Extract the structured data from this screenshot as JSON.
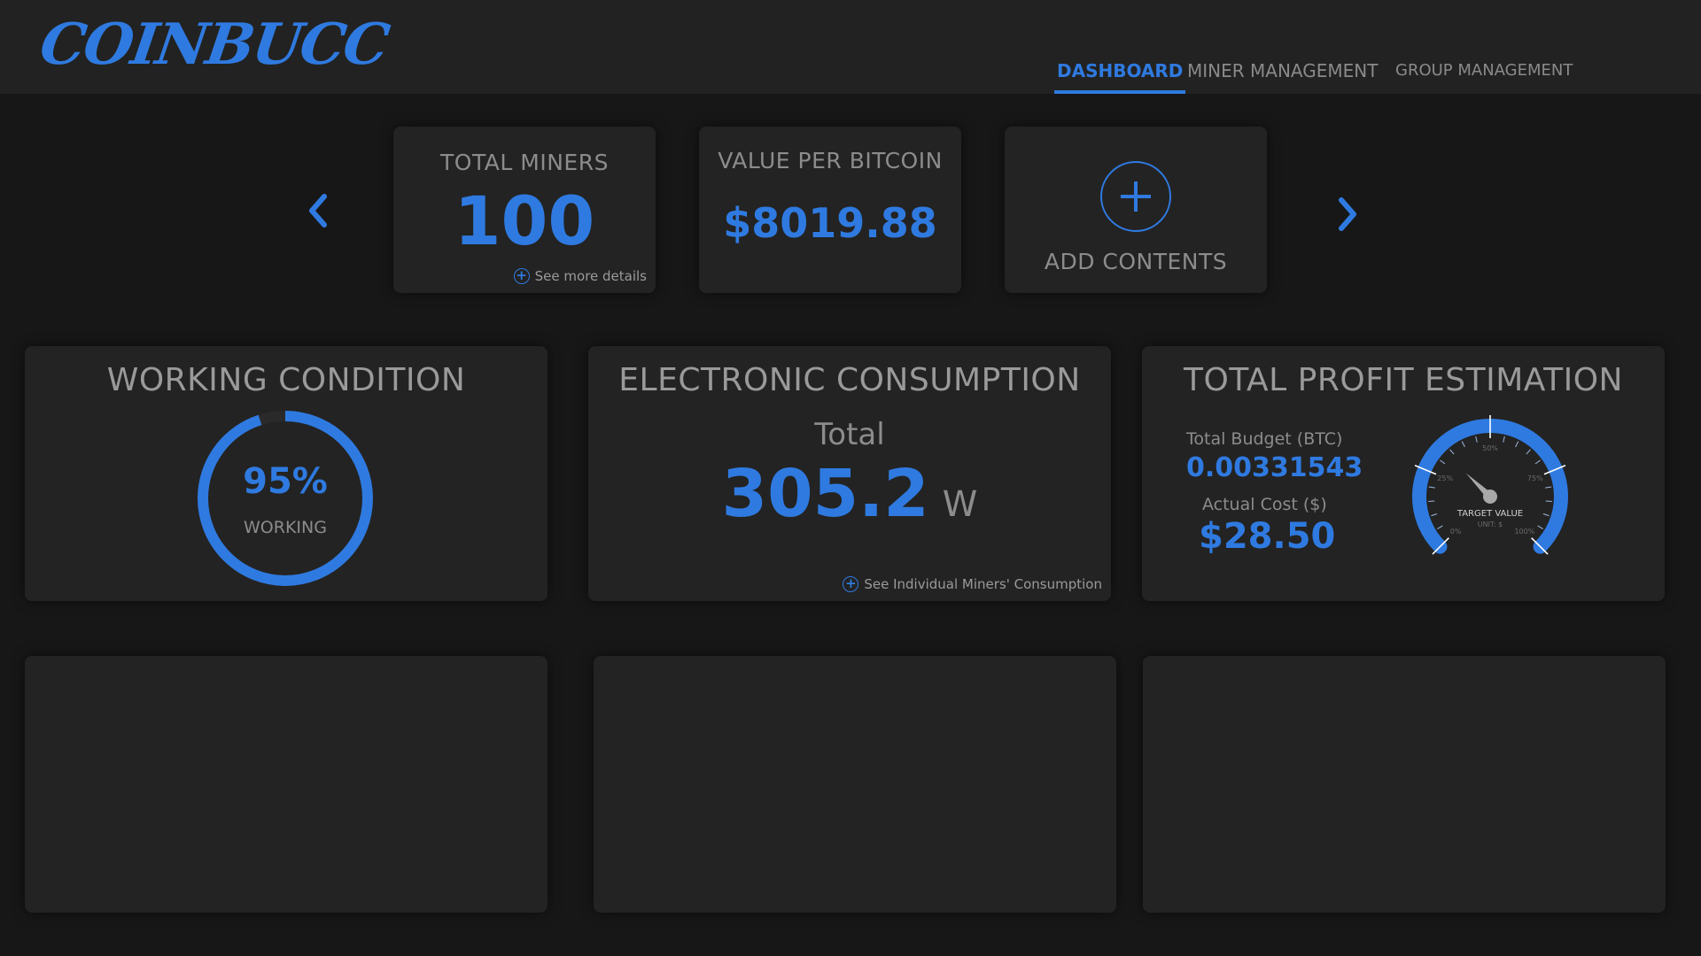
{
  "header": {
    "logo": "COINBUCC",
    "nav": [
      {
        "label": "DASHBOARD",
        "active": true
      },
      {
        "label": "MINER MANAGEMENT",
        "active": false
      },
      {
        "label": "GROUP MANAGEMENT",
        "active": false
      }
    ]
  },
  "carousel": {
    "prev_icon": "chevron-left-icon",
    "next_icon": "chevron-right-icon",
    "total_miners": {
      "title": "TOTAL MINERS",
      "value": "100",
      "link": "See more details"
    },
    "value_per_bitcoin": {
      "title": "VALUE PER BITCOIN",
      "value": "$8019.88"
    },
    "add_contents": {
      "label": "ADD CONTENTS",
      "icon": "plus-circle-icon"
    }
  },
  "working_condition": {
    "title": "WORKING CONDITION",
    "percent_text": "95%",
    "percent_value": 0.95,
    "label": "WORKING"
  },
  "electronic_consumption": {
    "title": "ELECTRONIC CONSUMPTION",
    "total_label": "Total",
    "value": "305.2",
    "unit": "W",
    "link": "See Individual Miners' Consumption"
  },
  "profit_estimation": {
    "title": "TOTAL PROFIT ESTIMATION",
    "budget_label": "Total Budget (BTC)",
    "budget_value": "0.00331543",
    "cost_label": "Actual Cost ($)",
    "cost_value": "$28.50",
    "gauge": {
      "ticks": [
        "0%",
        "25%",
        "50%",
        "75%",
        "100%"
      ],
      "title": "TARGET VALUE",
      "subtitle": "UNIT: $",
      "needle_fraction": 0.33
    }
  },
  "colors": {
    "accent": "#2f7ae0",
    "background": "#171717",
    "card": "#232323",
    "header": "#222222",
    "muted_text": "#8c8c8c"
  }
}
